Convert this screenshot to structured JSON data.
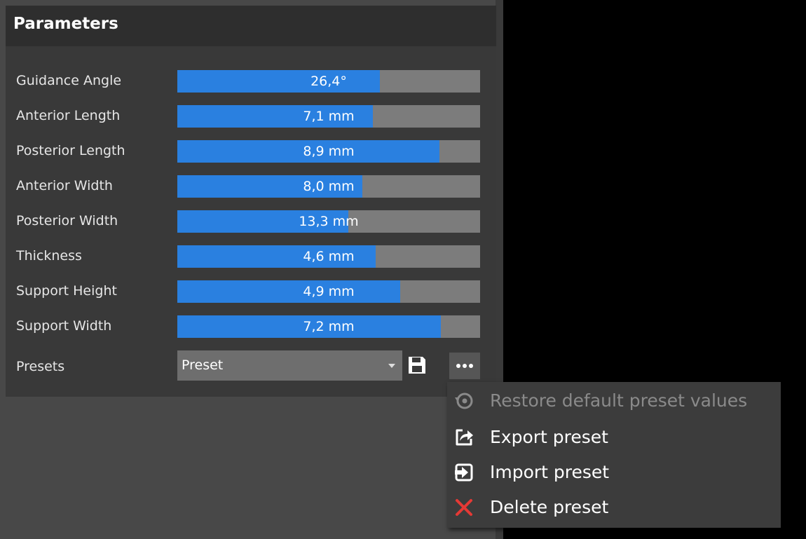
{
  "panel": {
    "title": "Parameters"
  },
  "sliders": [
    {
      "label": "Guidance Angle",
      "value": "26,4°",
      "fill_percent": 67
    },
    {
      "label": "Anterior Length",
      "value": "7,1 mm",
      "fill_percent": 64.5
    },
    {
      "label": "Posterior Length",
      "value": "8,9 mm",
      "fill_percent": 86.5
    },
    {
      "label": "Anterior Width",
      "value": "8,0 mm",
      "fill_percent": 61
    },
    {
      "label": "Posterior Width",
      "value": "13,3 mm",
      "fill_percent": 56.5
    },
    {
      "label": "Thickness",
      "value": "4,6 mm",
      "fill_percent": 65.5
    },
    {
      "label": "Support Height",
      "value": "4,9 mm",
      "fill_percent": 73.5
    },
    {
      "label": "Support Width",
      "value": "7,2 mm",
      "fill_percent": 87
    }
  ],
  "presets": {
    "label": "Presets",
    "selected": "Preset",
    "save_icon": "floppy-disk-icon",
    "more_icon": "ellipsis-icon"
  },
  "menu": {
    "items": [
      {
        "label": "Restore default preset values",
        "icon": "restore-icon",
        "enabled": false
      },
      {
        "label": "Export preset",
        "icon": "export-icon",
        "enabled": true
      },
      {
        "label": "Import preset",
        "icon": "import-icon",
        "enabled": true
      },
      {
        "label": "Delete preset",
        "icon": "delete-x-icon",
        "enabled": true
      }
    ]
  },
  "colors": {
    "accent": "#2a80e0",
    "slider_track": "#7c7c7c",
    "panel_bg": "#393939",
    "header_bg": "#2e2e2e",
    "delete_red": "#e53935"
  }
}
